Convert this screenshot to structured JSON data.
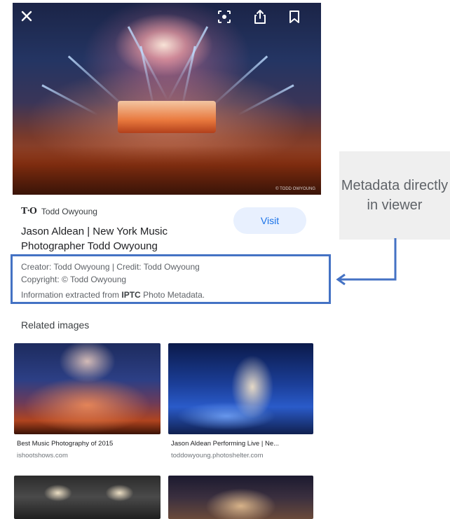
{
  "viewer": {
    "toolbar": {
      "close_icon": "close-icon",
      "lens_icon": "lens-icon",
      "share_icon": "share-icon",
      "bookmark_icon": "bookmark-icon"
    },
    "hero": {
      "watermark": "© TODD OWYOUNG"
    },
    "source": {
      "logo": "T·O",
      "name": "Todd Owyoung"
    },
    "title": "Jason Aldean | New York Music Photographer Todd Owyoung",
    "visit_label": "Visit",
    "metadata": {
      "creator_line": "Creator: Todd Owyoung | Credit: Todd Owyoung",
      "copyright_line": "Copyright: © Todd Owyoung",
      "info_prefix": "Information extracted from ",
      "info_bold": "IPTC",
      "info_suffix": " Photo Metadata."
    },
    "related": {
      "title": "Related images",
      "items": [
        {
          "title": "Best Music Photography of 2015",
          "site": "ishootshows.com"
        },
        {
          "title": "Jason Aldean Performing Live | Ne...",
          "site": "toddowyoung.photoshelter.com"
        },
        {
          "title": "",
          "site": ""
        },
        {
          "title": "",
          "site": ""
        }
      ]
    }
  },
  "annotation": {
    "callout_text": "Metadata directly in viewer",
    "border_color": "#4472c4"
  }
}
